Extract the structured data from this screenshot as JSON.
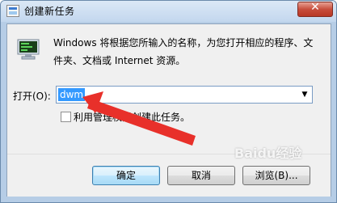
{
  "window": {
    "title": "创建新任务",
    "close_symbol": "✕"
  },
  "description": "Windows 将根据您所输入的名称，为您打开相应的程序、文件夹、文档或 Internet 资源。",
  "open_field": {
    "label": "打开(O):",
    "value": "dwm",
    "arrow": "▼"
  },
  "admin_checkbox": {
    "label": "利用管理权限创建此任务。",
    "checked": false
  },
  "buttons": {
    "ok": "确定",
    "cancel": "取消",
    "browse": "浏览(B)..."
  },
  "watermark": "Baidu经验",
  "colors": {
    "annotation_arrow": "#e8302a",
    "selection": "#3399ff"
  },
  "icons": {
    "title": "task-window-icon",
    "run": "run-dialog-icon"
  }
}
